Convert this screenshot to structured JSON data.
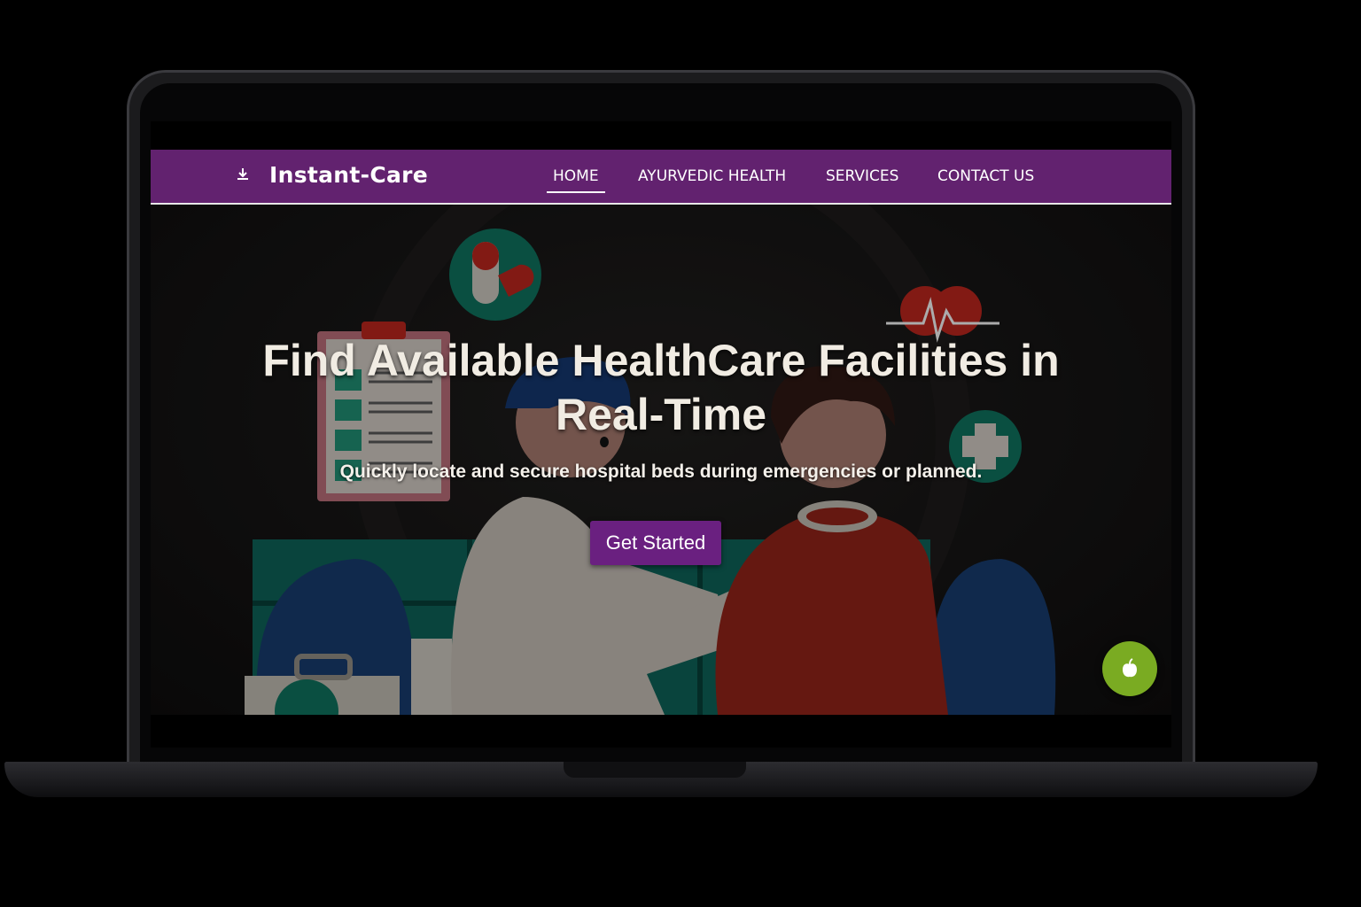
{
  "app": {
    "brand": "Instant-Care",
    "brand_icon": "download-icon"
  },
  "nav": {
    "items": [
      {
        "label": "HOME",
        "active": true
      },
      {
        "label": "AYURVEDIC HEALTH",
        "active": false
      },
      {
        "label": "SERVICES",
        "active": false
      },
      {
        "label": "CONTACT US",
        "active": false
      }
    ]
  },
  "hero": {
    "title_line1": "Find Available HealthCare Facilities in",
    "title_line2": "Real-Time",
    "subtitle": "Quickly locate and secure hospital beds during emergencies or planned.",
    "cta_label": "Get Started",
    "illustration": "doctor-examining-patient-illustration"
  },
  "fab": {
    "icon": "apple-icon"
  },
  "colors": {
    "navbar": "#62226f",
    "cta": "#6a2080",
    "fab": "#7aab22",
    "text": "#f1ece3"
  }
}
